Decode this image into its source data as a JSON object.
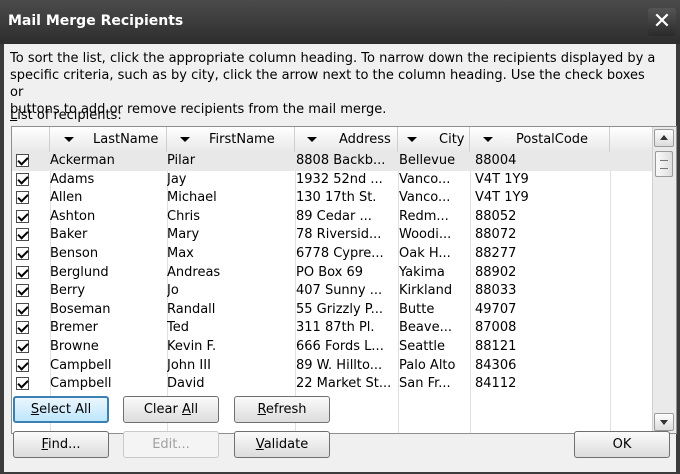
{
  "dialog": {
    "title": "Mail Merge Recipients",
    "close_symbol": "✕"
  },
  "instructions": {
    "line1": "To sort the list, click the appropriate column heading.  To narrow down the recipients displayed by a",
    "line2": "specific criteria, such as by city, click the arrow next to the column heading.  Use the check boxes or",
    "line3": "buttons to add or remove recipients from the mail merge."
  },
  "list_label_prefix": "L",
  "list_label_rest": "ist of recipients:",
  "columns": [
    {
      "label": "LastName"
    },
    {
      "label": "FirstName"
    },
    {
      "label": "Address"
    },
    {
      "label": "City"
    },
    {
      "label": "PostalCode"
    }
  ],
  "rows": [
    {
      "checked": true,
      "last": "Ackerman",
      "first": "Pilar",
      "address": "8808 Backb...",
      "city": "Bellevue",
      "postal": "88004"
    },
    {
      "checked": true,
      "last": "Adams",
      "first": "Jay",
      "address": "1932 52nd ...",
      "city": "Vanco...",
      "postal": "V4T 1Y9"
    },
    {
      "checked": true,
      "last": "Allen",
      "first": "Michael",
      "address": "130 17th St.",
      "city": "Vanco...",
      "postal": "V4T 1Y9"
    },
    {
      "checked": true,
      "last": "Ashton",
      "first": "Chris",
      "address": "89 Cedar ...",
      "city": "Redm...",
      "postal": "88052"
    },
    {
      "checked": true,
      "last": "Baker",
      "first": "Mary",
      "address": "78 Riversid...",
      "city": "Woodi...",
      "postal": "88072"
    },
    {
      "checked": true,
      "last": "Benson",
      "first": "Max",
      "address": "6778 Cypre...",
      "city": "Oak H...",
      "postal": "88277"
    },
    {
      "checked": true,
      "last": "Berglund",
      "first": "Andreas",
      "address": "PO Box 69",
      "city": "Yakima",
      "postal": "88902"
    },
    {
      "checked": true,
      "last": "Berry",
      "first": "Jo",
      "address": "407 Sunny ...",
      "city": "Kirkland",
      "postal": "88033"
    },
    {
      "checked": true,
      "last": "Boseman",
      "first": "Randall",
      "address": "55 Grizzly P...",
      "city": "Butte",
      "postal": "49707"
    },
    {
      "checked": true,
      "last": "Bremer",
      "first": "Ted",
      "address": "311 87th Pl.",
      "city": "Beave...",
      "postal": "87008"
    },
    {
      "checked": true,
      "last": "Browne",
      "first": "Kevin F.",
      "address": "666 Fords L...",
      "city": "Seattle",
      "postal": "88121"
    },
    {
      "checked": true,
      "last": "Campbell",
      "first": "John III",
      "address": "89 W. Hillto...",
      "city": "Palo Alto",
      "postal": "84306"
    },
    {
      "checked": true,
      "last": "Campbell",
      "first": "David",
      "address": "22 Market St...",
      "city": "San Fr...",
      "postal": "84112"
    }
  ],
  "buttons": {
    "select_all": {
      "u": "S",
      "rest": "elect All"
    },
    "clear_all": {
      "pre": "Clear ",
      "u": "A",
      "rest": "ll"
    },
    "refresh": {
      "u": "R",
      "rest": "efresh"
    },
    "find": {
      "u": "F",
      "rest": "ind..."
    },
    "edit": {
      "label": "Edit..."
    },
    "validate": {
      "u": "V",
      "rest": "alidate"
    },
    "ok": {
      "label": "OK"
    }
  },
  "icons": {
    "close": "close-icon",
    "checkbox": "checkmark-icon",
    "column_dropdown": "chevron-down-icon",
    "scroll_up": "scroll-up-arrow-icon",
    "scroll_down": "scroll-down-arrow-icon"
  }
}
